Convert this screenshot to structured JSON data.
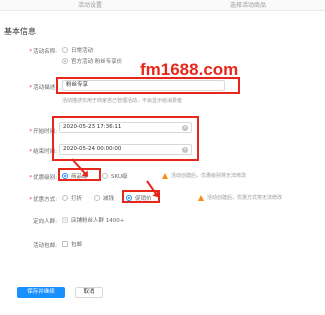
{
  "tabs": [
    "活动设置",
    "选择活动商品"
  ],
  "section_title": "基本信息",
  "activity_name": {
    "label": "活动名称:",
    "options": [
      "日常活动",
      "官方活动 粉丝专享价"
    ]
  },
  "description": {
    "label": "活动描述:",
    "value": "粉丝专享",
    "hint": "活动描述仅用于商家自己管理活动，不会显示给消费者"
  },
  "start_time": {
    "label": "开始时间:",
    "value": "2020-05-23 17:36:11"
  },
  "end_time": {
    "label": "结束时间:",
    "value": "2020-05-24 00:00:00"
  },
  "level": {
    "label": "优惠级别:",
    "options": [
      "商品级",
      "SKU级"
    ],
    "warning": "活动创建后，优惠级别将无法修改"
  },
  "method": {
    "label": "优惠方式:",
    "options": [
      "打折",
      "减钱",
      "促销价"
    ],
    "warning": "活动创建后，优惠方式将无法修改"
  },
  "audience": {
    "label": "定向人群:",
    "value": "店铺粉丝人群 1400+"
  },
  "shipping": {
    "label": "活动包邮:",
    "value": "包邮"
  },
  "buttons": {
    "save": "保存并继续",
    "cancel": "取消"
  },
  "watermark": "fm1688.com",
  "colors": {
    "accent": "#1890ff",
    "annotation": "#e8271c",
    "warning": "#fa8c16"
  }
}
